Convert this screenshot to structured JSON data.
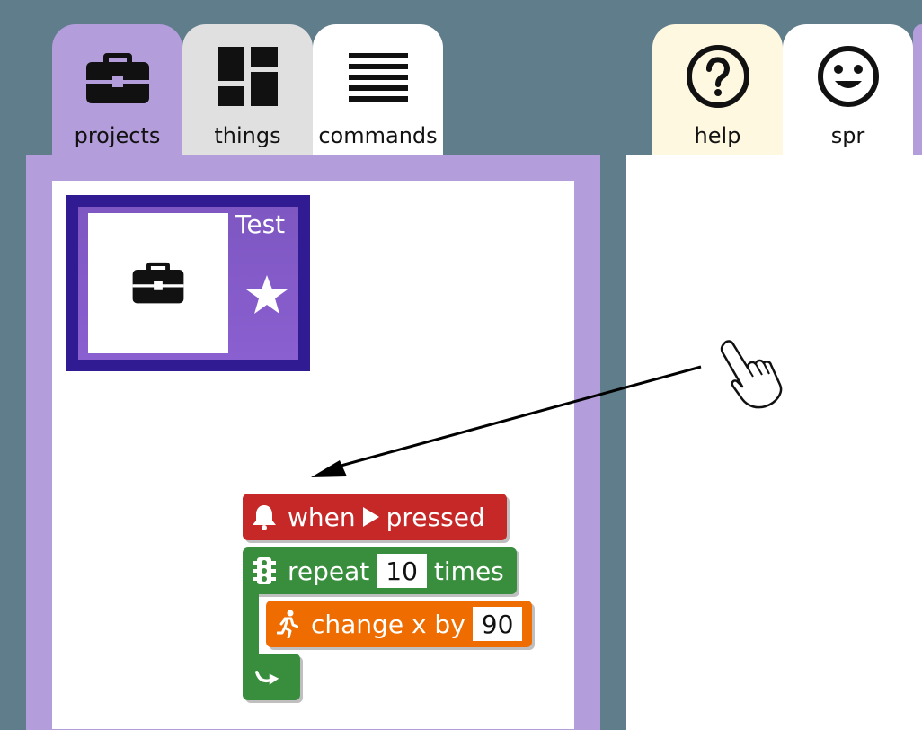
{
  "tabs": {
    "projects": {
      "label": "projects",
      "icon": "briefcase-icon"
    },
    "things": {
      "label": "things",
      "icon": "dashboard-icon"
    },
    "commands": {
      "label": "commands",
      "icon": "lines-icon"
    },
    "help": {
      "label": "help",
      "icon": "question-icon"
    },
    "spr": {
      "label": "spr",
      "icon": "smiley-icon"
    }
  },
  "project_card": {
    "title": "Test",
    "thumbnail_icon": "briefcase-icon",
    "star_icon": "star-icon"
  },
  "blocks": {
    "when": {
      "text_before": "when",
      "text_after": "pressed",
      "icon": "bell-icon"
    },
    "repeat": {
      "text_before": "repeat",
      "count": "10",
      "text_after": "times",
      "icon": "traffic-light-icon"
    },
    "change": {
      "text": "change x by",
      "value": "90",
      "icon": "runner-icon"
    },
    "end": {
      "icon": "loop-back-icon"
    }
  },
  "colors": {
    "background": "#607d8b",
    "projects_tab": "#b39ddb",
    "card_border": "#311b92",
    "card_fill": "#7e57c2",
    "event_block": "#c62828",
    "control_block": "#388e3c",
    "motion_block": "#ef6c00"
  }
}
